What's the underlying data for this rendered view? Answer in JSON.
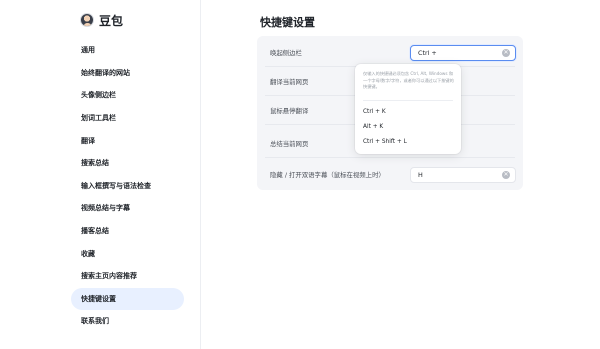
{
  "app": {
    "name": "豆包"
  },
  "sidebar": {
    "items": [
      {
        "label": "通用"
      },
      {
        "label": "始终翻译的网站"
      },
      {
        "label": "头像侧边栏"
      },
      {
        "label": "划词工具栏"
      },
      {
        "label": "翻译"
      },
      {
        "label": "搜索总结"
      },
      {
        "label": "输入框撰写与语法检查"
      },
      {
        "label": "视频总结与字幕"
      },
      {
        "label": "播客总结"
      },
      {
        "label": "收藏"
      },
      {
        "label": "搜索主页内容推荐"
      },
      {
        "label": "快捷键设置",
        "active": true
      },
      {
        "label": "联系我们"
      }
    ]
  },
  "main": {
    "title": "快捷键设置",
    "shortcuts": [
      {
        "label": "唤起侧边栏",
        "value": "Ctrl +"
      },
      {
        "label": "翻译当前网页",
        "value": ""
      },
      {
        "label": "鼠标悬停翻译",
        "value": ""
      },
      {
        "label": "总结当前网页",
        "value": ""
      },
      {
        "label": "隐藏 / 打开双语字幕（鼠标在视频上时）",
        "value": "H"
      }
    ],
    "popover": {
      "hint": "仅输入的快捷键必须包含 Ctrl, Alt, Windows 和一个字母/数字/字符，或者你可以通过以下按键的快捷键。",
      "options": [
        "Ctrl + K",
        "Alt + K",
        "Ctrl + Shift + L"
      ]
    }
  },
  "colors": {
    "accent": "#5a8cf0",
    "active_nav_bg": "#e8f0ff",
    "card_bg": "#f4f5f8"
  }
}
